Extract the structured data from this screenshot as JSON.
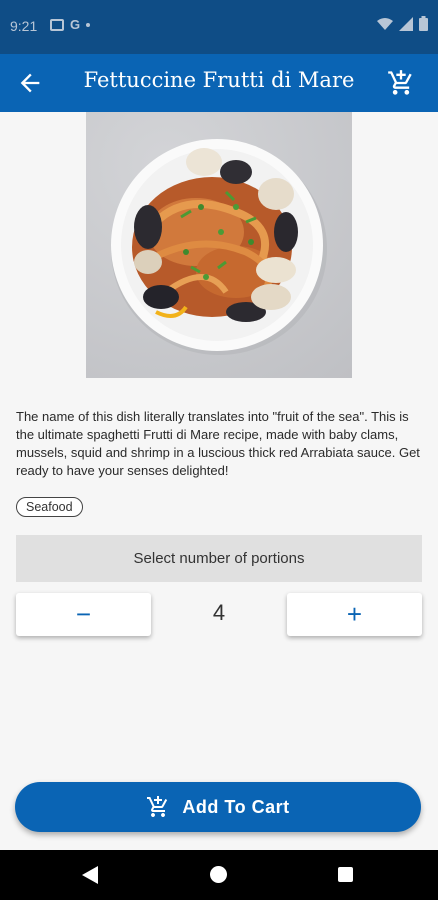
{
  "status_bar": {
    "time": "9:21",
    "letter_g": "G"
  },
  "app_bar": {
    "title": "Fettuccine Frutti di Mare",
    "back_icon": "arrow-back-icon",
    "cart_icon": "add-shopping-cart-icon"
  },
  "recipe": {
    "description": "The name of this dish literally translates into \"fruit of the sea\". This is the ultimate spaghetti Frutti di Mare recipe, made with baby clams, mussels, squid and shrimp in a luscious thick red Arrabiata sauce. Get ready to have your senses delighted!",
    "tag": "Seafood"
  },
  "portions": {
    "header": "Select number of portions",
    "minus_label": "−",
    "value": "4",
    "plus_label": "+"
  },
  "cart_button": {
    "label": "Add To Cart"
  },
  "colors": {
    "primary": "#0a64b4",
    "status_bar": "#0f4d86"
  }
}
